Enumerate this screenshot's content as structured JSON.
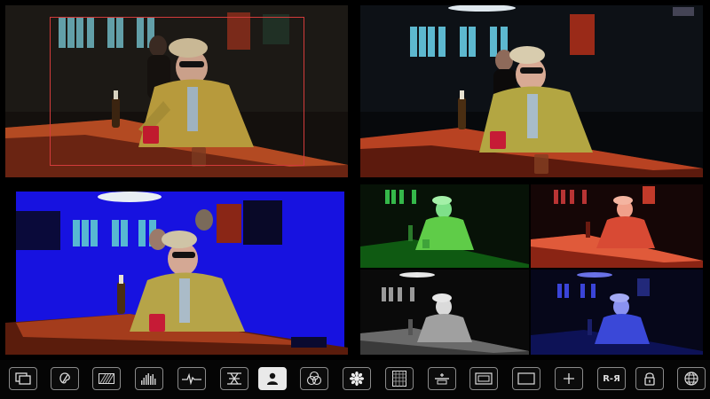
{
  "app": {
    "background": "#000000",
    "accent_red": "#d23b3b"
  },
  "viewports": [
    {
      "id": "original-with-roi",
      "mode": "normal",
      "roi_visible": true
    },
    {
      "id": "contrast-enhanced",
      "mode": "normal"
    },
    {
      "id": "false-color-blue",
      "mode": "false-color",
      "color": "#1712e0"
    },
    {
      "id": "rgb-channel-split",
      "mode": "channels",
      "channels": [
        "green",
        "red",
        "luma",
        "blue"
      ]
    }
  ],
  "toolbar": {
    "items": [
      {
        "name": "multiview-icon",
        "active": false
      },
      {
        "name": "color-palette-icon",
        "active": false
      },
      {
        "name": "zebra-stripes-icon",
        "active": false
      },
      {
        "name": "histogram-icon",
        "active": false
      },
      {
        "name": "waveform-icon",
        "active": false
      },
      {
        "name": "focus-peaking-icon",
        "active": false
      },
      {
        "name": "person-icon",
        "active": true
      },
      {
        "name": "rgb-circles-icon",
        "active": false
      },
      {
        "name": "gear-icon",
        "active": false
      },
      {
        "name": "grid-icon",
        "active": false
      },
      {
        "name": "level-icon",
        "active": false
      },
      {
        "name": "safe-area-icon",
        "active": false
      },
      {
        "name": "frame-guide-icon",
        "active": false
      },
      {
        "name": "crosshair-icon",
        "active": false
      },
      {
        "name": "mirror-label",
        "label": "R-Я",
        "active": false
      },
      {
        "name": "lock-icon",
        "active": false
      },
      {
        "name": "globe-icon",
        "active": false
      }
    ]
  }
}
